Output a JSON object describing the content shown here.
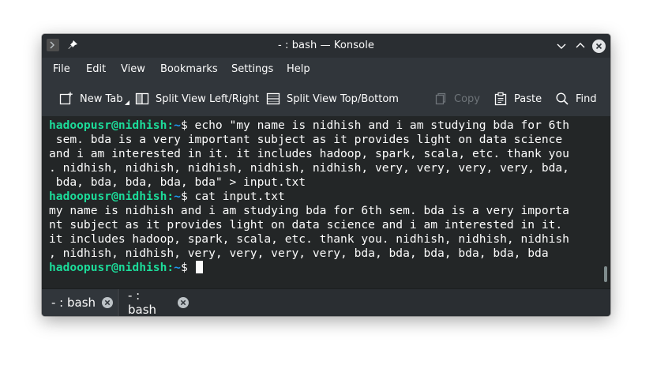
{
  "window": {
    "title": "- : bash — Konsole"
  },
  "menubar": {
    "items": [
      "File",
      "Edit",
      "View",
      "Bookmarks",
      "Settings",
      "Help"
    ]
  },
  "toolbar": {
    "new_tab": "New Tab",
    "split_left_right": "Split View Left/Right",
    "split_top_bottom": "Split View Top/Bottom",
    "copy": "Copy",
    "paste": "Paste",
    "find": "Find"
  },
  "terminal": {
    "prompt": {
      "user_host": "hadoopusr@nidhish",
      "separator": ":",
      "path": "~",
      "symbol": "$"
    },
    "lines": [
      {
        "type": "prompt",
        "command": " echo \"my name is nidhish and i am studying bda for 6th"
      },
      {
        "type": "text",
        "text": " sem. bda is a very important subject as it provides light on data science"
      },
      {
        "type": "text",
        "text": "and i am interested in it. it includes hadoop, spark, scala, etc. thank you"
      },
      {
        "type": "text",
        "text": ". nidhish, nidhish, nidhish, nidhish, nidhish, very, very, very, very, bda,"
      },
      {
        "type": "text",
        "text": " bda, bda, bda, bda, bda\" > input.txt"
      },
      {
        "type": "prompt",
        "command": " cat input.txt"
      },
      {
        "type": "text",
        "text": "my name is nidhish and i am studying bda for 6th sem. bda is a very importa"
      },
      {
        "type": "text",
        "text": "nt subject as it provides light on data science and i am interested in it."
      },
      {
        "type": "text",
        "text": "it includes hadoop, spark, scala, etc. thank you. nidhish, nidhish, nidhish"
      },
      {
        "type": "text",
        "text": ", nidhish, nidhish, very, very, very, very, bda, bda, bda, bda, bda, bda"
      },
      {
        "type": "prompt",
        "command": " "
      }
    ]
  },
  "tabs": [
    {
      "label": "- : bash",
      "active": true
    },
    {
      "label": "- : bash",
      "active": false
    }
  ],
  "colors": {
    "prompt_user": "#1cdc9a",
    "prompt_path": "#1d99f3",
    "terminal_bg": "#232627",
    "chrome_bg": "#31363b"
  }
}
